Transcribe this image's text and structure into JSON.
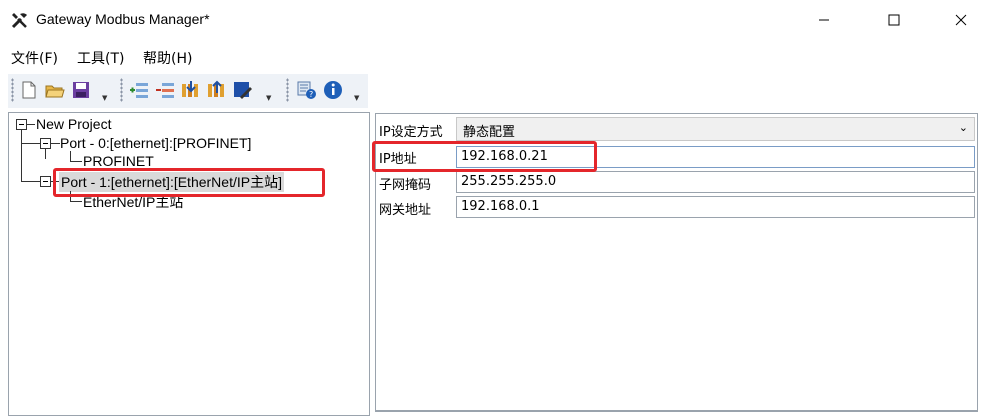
{
  "window": {
    "title": "Gateway Modbus Manager*"
  },
  "menu": [
    {
      "label": "文件(F)"
    },
    {
      "label": "工具(T)"
    },
    {
      "label": "帮助(H)"
    }
  ],
  "tree": {
    "root": "New Project",
    "port0": "Port - 0:[ethernet]:[PROFINET]",
    "port0_child": "PROFINET",
    "port1": "Port - 1:[ethernet]:[EtherNet/IP主站]",
    "port1_child": "EtherNet/IP主站"
  },
  "properties": {
    "mode_label": "IP设定方式",
    "mode_value": "静态配置",
    "ip_label": "IP地址",
    "ip_value": "192.168.0.21",
    "mask_label": "子网掩码",
    "mask_value": "255.255.255.0",
    "gateway_label": "网关地址",
    "gateway_value": "192.168.0.1"
  },
  "colors": {
    "highlight": "#e4262b",
    "toolbar_bg": "#eef2f7",
    "selected_bg": "#d9d9d9"
  }
}
